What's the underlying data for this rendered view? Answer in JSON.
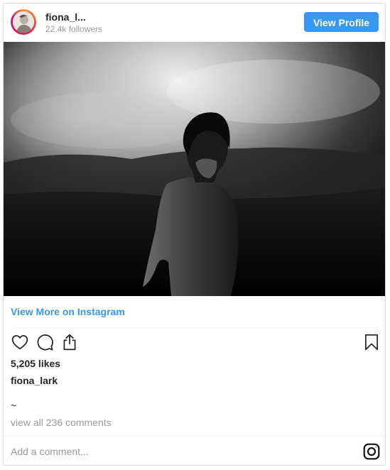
{
  "header": {
    "username": "fiona_l...",
    "followers": "22.4k followers",
    "view_profile_label": "View Profile"
  },
  "photo": {
    "description_icon": "post-photo"
  },
  "links": {
    "view_more": "View More on Instagram",
    "view_all_comments": "view all 236 comments"
  },
  "actions": {
    "icons": [
      "heart-icon",
      "comment-icon",
      "share-icon",
      "bookmark-icon"
    ]
  },
  "post": {
    "likes": "5,205 likes",
    "caption_user": "fiona_lark",
    "caption_text": "~"
  },
  "comment": {
    "placeholder": "Add a comment..."
  },
  "colors": {
    "accent": "#3897f0",
    "muted": "#999999",
    "text": "#262626",
    "border": "#dbdbdb"
  }
}
